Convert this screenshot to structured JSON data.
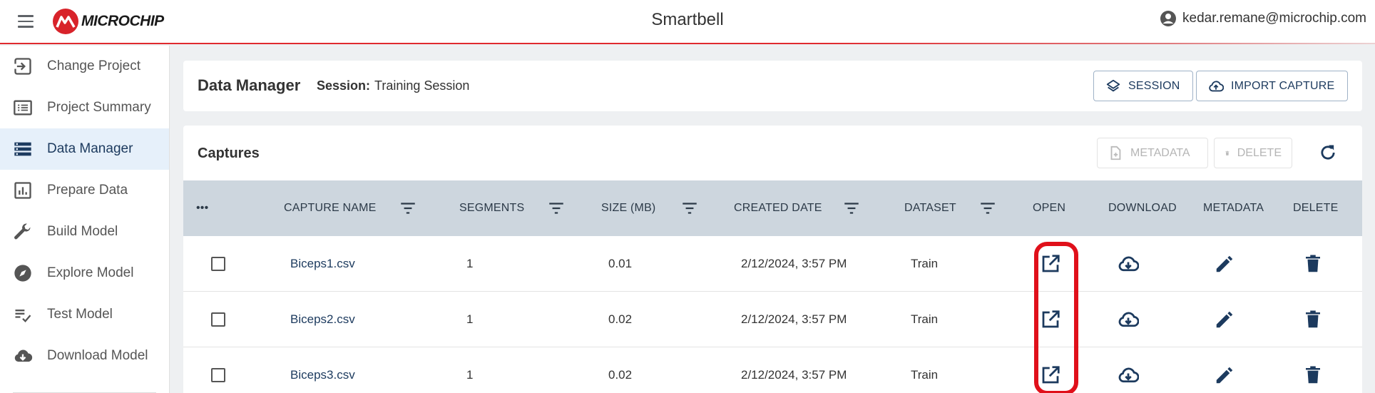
{
  "header": {
    "logo_text": "MICROCHIP",
    "app_title": "Smartbell",
    "user_email": "kedar.remane@microchip.com"
  },
  "sidebar": {
    "items": [
      {
        "label": "Change Project",
        "icon": "login-icon"
      },
      {
        "label": "Project Summary",
        "icon": "list-icon"
      },
      {
        "label": "Data Manager",
        "icon": "storage-icon",
        "active": true
      },
      {
        "label": "Prepare Data",
        "icon": "chart-icon"
      },
      {
        "label": "Build Model",
        "icon": "wrench-icon"
      },
      {
        "label": "Explore Model",
        "icon": "compass-icon"
      },
      {
        "label": "Test Model",
        "icon": "checklist-icon"
      },
      {
        "label": "Download Model",
        "icon": "cloud-download-icon"
      }
    ]
  },
  "data_manager": {
    "title": "Data Manager",
    "session_label": "Session:",
    "session_value": "Training Session",
    "session_button": "SESSION",
    "import_button": "IMPORT CAPTURE"
  },
  "captures": {
    "title": "Captures",
    "metadata_button": "METADATA",
    "delete_button": "DELETE",
    "columns": {
      "menu": "•••",
      "capture_name": "CAPTURE NAME",
      "segments": "SEGMENTS",
      "size": "SIZE (MB)",
      "created_date": "CREATED DATE",
      "dataset": "DATASET",
      "open": "OPEN",
      "download": "DOWNLOAD",
      "metadata": "METADATA",
      "delete": "DELETE"
    },
    "rows": [
      {
        "name": "Biceps1.csv",
        "segments": "1",
        "size": "0.01",
        "created": "2/12/2024, 3:57 PM",
        "dataset": "Train"
      },
      {
        "name": "Biceps2.csv",
        "segments": "1",
        "size": "0.02",
        "created": "2/12/2024, 3:57 PM",
        "dataset": "Train"
      },
      {
        "name": "Biceps3.csv",
        "segments": "1",
        "size": "0.02",
        "created": "2/12/2024, 3:57 PM",
        "dataset": "Train"
      }
    ]
  },
  "colors": {
    "accent_red": "#d8232a",
    "navy": "#1c3a5e",
    "table_header_bg": "#cdd6de",
    "active_sidebar_bg": "#e6f0fa"
  }
}
